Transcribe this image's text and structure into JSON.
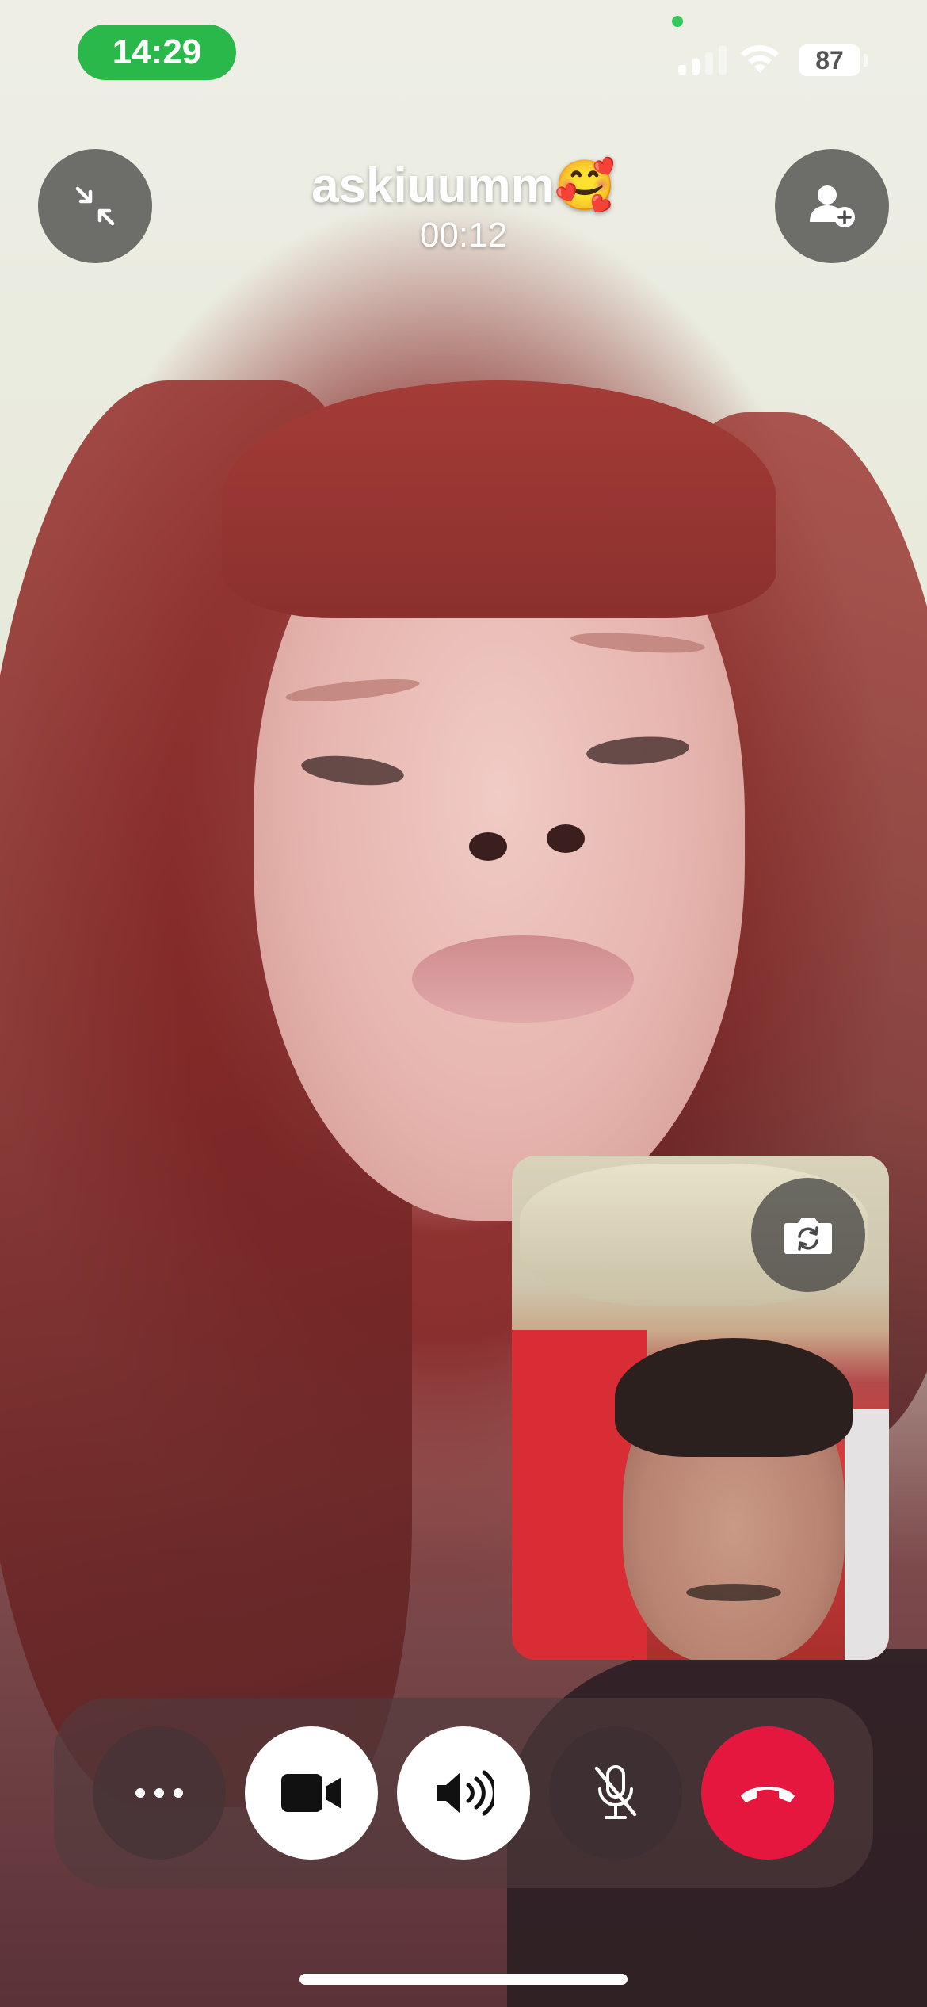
{
  "status_bar": {
    "time": "14:29",
    "battery": "87",
    "signal_bars": 2,
    "icons": [
      "signal-icon",
      "wifi-icon",
      "battery-icon"
    ]
  },
  "call": {
    "caller_name": "askiuumm🥰",
    "duration": "00:12"
  },
  "controls": {
    "top": [
      "minimize-icon",
      "add-person-icon"
    ],
    "self_view": [
      "flip-camera-icon"
    ],
    "bottom": [
      "more-icon",
      "video-camera-icon",
      "speaker-icon",
      "mic-muted-icon",
      "end-call-icon"
    ]
  },
  "colors": {
    "time_pill": "#2bb84a",
    "end_call": "#e6173f",
    "control_bar": "#503c3e",
    "active_toggle": "#ffffff"
  }
}
